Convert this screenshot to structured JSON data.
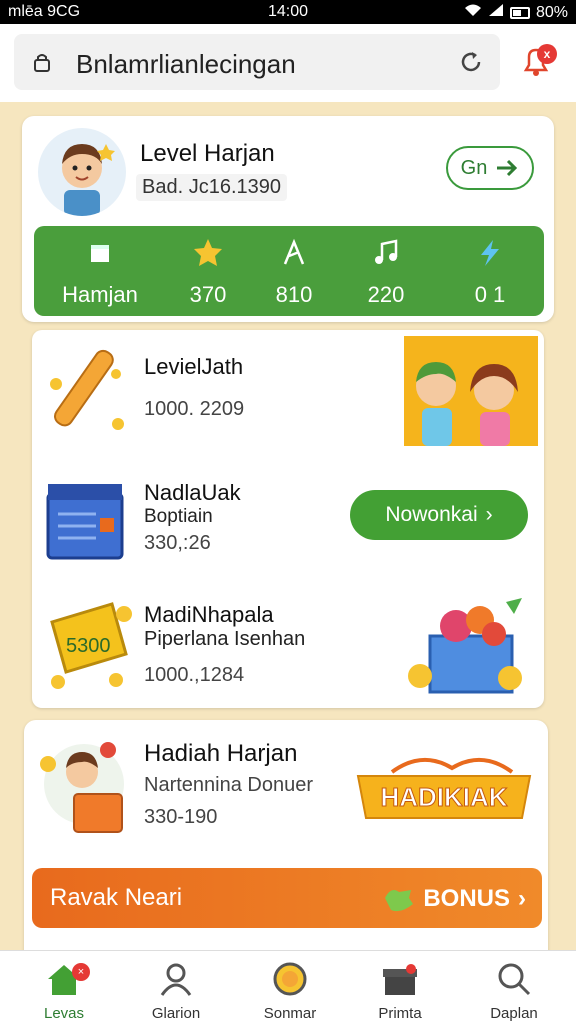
{
  "status_bar": {
    "carrier": "mlēa 9CG",
    "time": "14:00",
    "battery": "80%"
  },
  "browser": {
    "url_text": "Bnlamrlianlecingan",
    "notification_badge": "x"
  },
  "level_card": {
    "title": "Level Harjan",
    "subtitle": "Bad. Jc16.1390",
    "go_label": "Gn",
    "stats": [
      {
        "icon": "box-icon",
        "value": "Hamjan"
      },
      {
        "icon": "star-icon",
        "value": "370"
      },
      {
        "icon": "note-icon",
        "value": "810"
      },
      {
        "icon": "music-icon",
        "value": "220"
      },
      {
        "icon": "lightning-icon",
        "value": "0 1"
      }
    ]
  },
  "reward_list": [
    {
      "title": "LevielJath",
      "number": "1000. 2209"
    },
    {
      "title": "NadlaUak",
      "subtitle": "Boptiain",
      "number": "330,:26",
      "button": "Nowonkai"
    },
    {
      "title": "MadiNhapala",
      "subtitle": "Piperlana Isenhan",
      "number": "1000.,1284",
      "badge": "5300"
    }
  ],
  "hadiah_card": {
    "title": "Hadiah Harjan",
    "subtitle": "Nartennina Donuer",
    "number": "330-190",
    "banner": "HADIKIAK",
    "bonus_left": "Ravak Neari",
    "bonus_right": "BONUS"
  },
  "bottom_nav": [
    {
      "label": "Levas",
      "icon": "home-icon",
      "active": true
    },
    {
      "label": "Glarion",
      "icon": "user-icon"
    },
    {
      "label": "Sonmar",
      "icon": "coin-icon"
    },
    {
      "label": "Primta",
      "icon": "gift-icon"
    },
    {
      "label": "Daplan",
      "icon": "search-icon"
    }
  ]
}
